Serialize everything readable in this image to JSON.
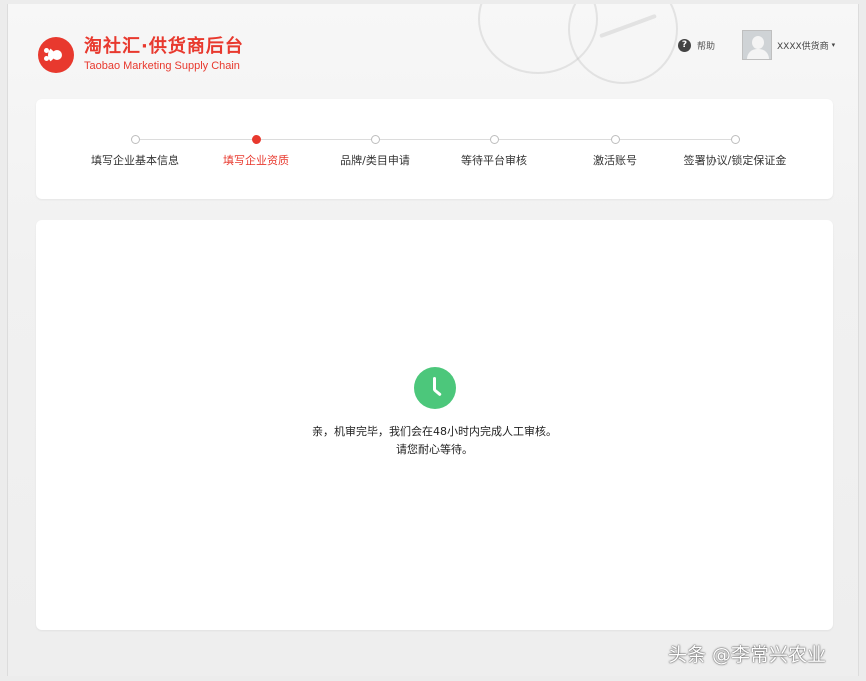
{
  "header": {
    "logo_title": "淘社汇·供货商后台",
    "logo_subtitle": "Taobao Marketing Supply Chain",
    "help_label": "帮助",
    "user_name": "XXXX供货商",
    "caret": "▾"
  },
  "steps": [
    {
      "label": "填写企业基本信息",
      "active": false
    },
    {
      "label": "填写企业资质",
      "active": true
    },
    {
      "label": "品牌/类目申请",
      "active": false
    },
    {
      "label": "等待平台审核",
      "active": false
    },
    {
      "label": "激活账号",
      "active": false
    },
    {
      "label": "签署协议/锁定保证金",
      "active": false
    }
  ],
  "main": {
    "message_line1": "亲，机审完毕，我们会在48小时内完成人工审核。",
    "message_line2": "请您耐心等待。"
  },
  "watermark": "头条 @李常兴农业",
  "colors": {
    "brand": "#e8392e",
    "clock": "#4cc77b",
    "background": "#ececec"
  }
}
